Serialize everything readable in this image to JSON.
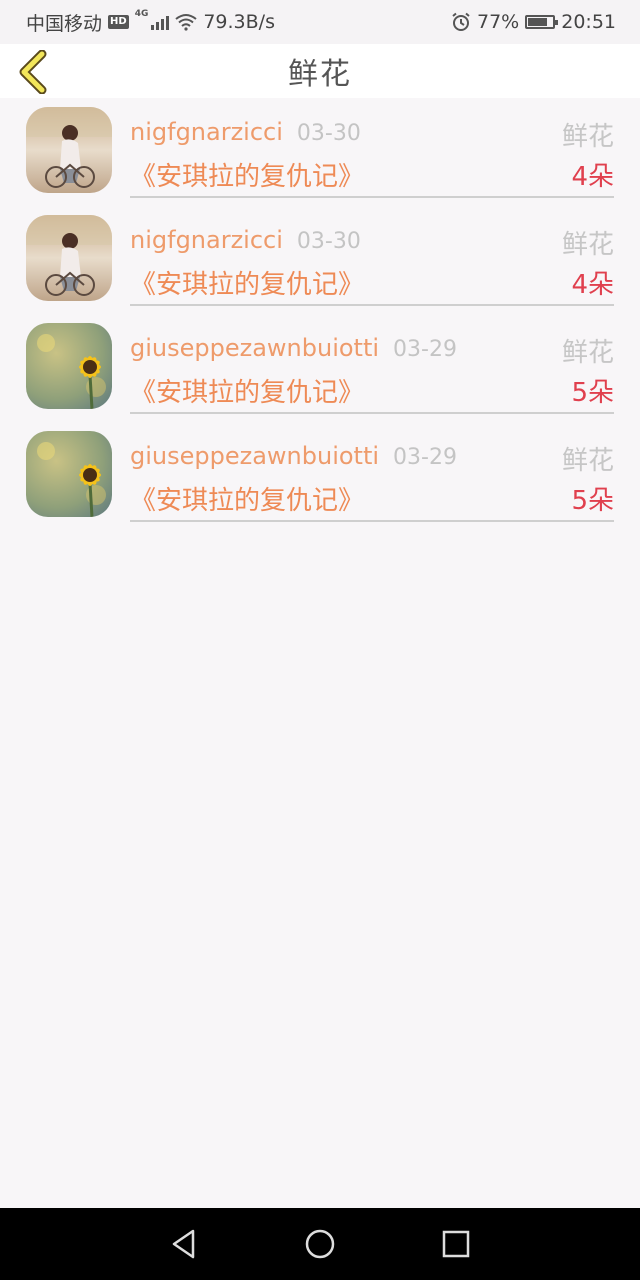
{
  "status_bar": {
    "carrier": "中国移动",
    "hd": "HD",
    "network": "4G",
    "speed": "79.3B/s",
    "battery_pct": "77%",
    "battery_level": 0.77,
    "time": "20:51"
  },
  "header": {
    "title": "鲜花"
  },
  "list": {
    "items": [
      {
        "user": "nigfgnarzicci",
        "date": "03-30",
        "book": "《安琪拉的复仇记》",
        "gift": "鲜花",
        "count": "4朵",
        "avatar": "girl-bicycle-avatar"
      },
      {
        "user": "nigfgnarzicci",
        "date": "03-30",
        "book": "《安琪拉的复仇记》",
        "gift": "鲜花",
        "count": "4朵",
        "avatar": "girl-bicycle-avatar"
      },
      {
        "user": "giuseppezawnbuiotti",
        "date": "03-29",
        "book": "《安琪拉的复仇记》",
        "gift": "鲜花",
        "count": "5朵",
        "avatar": "sunflower-avatar"
      },
      {
        "user": "giuseppezawnbuiotti",
        "date": "03-29",
        "book": "《安琪拉的复仇记》",
        "gift": "鲜花",
        "count": "5朵",
        "avatar": "sunflower-avatar"
      }
    ]
  },
  "colors": {
    "username": "#ee9b6b",
    "book": "#ee8a55",
    "count": "#e0404e",
    "back_arrow": "#f2e65a"
  },
  "icons": {
    "back": "chevron-left-icon",
    "nav_back": "triangle-back-icon",
    "nav_home": "circle-home-icon",
    "nav_recents": "square-recents-icon"
  }
}
